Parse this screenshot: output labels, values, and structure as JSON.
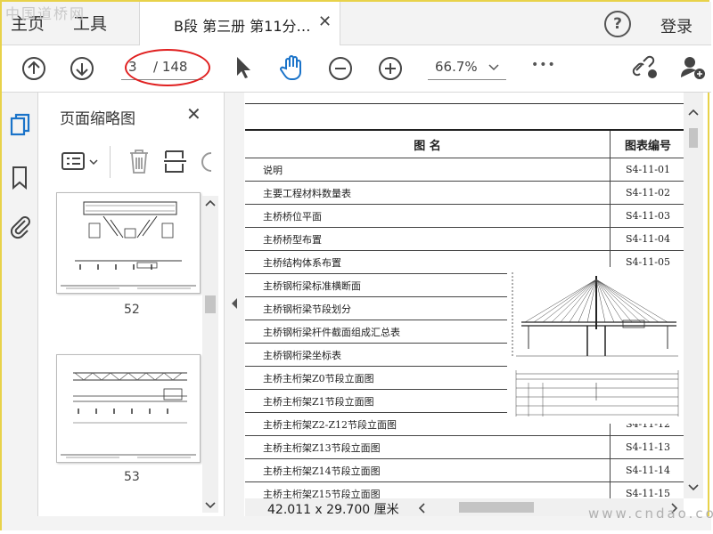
{
  "watermark_top": "中国道桥网",
  "menu": {
    "home": "主页",
    "tools": "工具"
  },
  "tab": {
    "title": "B段 第三册 第11分…",
    "close": "✕"
  },
  "header": {
    "help": "?",
    "login": "登录"
  },
  "toolbar": {
    "page_current": "3",
    "page_total": "/ 148",
    "zoom": "66.7%",
    "more": "•••"
  },
  "panel": {
    "title": "页面缩略图",
    "close": "✕",
    "thumbs": [
      {
        "label": "52"
      },
      {
        "label": "53"
      }
    ]
  },
  "document": {
    "header_name": "图  名",
    "header_code": "图表编号",
    "rows": [
      {
        "name": "说明",
        "code": "S4-11-01"
      },
      {
        "name": "主要工程材料数量表",
        "code": "S4-11-02"
      },
      {
        "name": "主桥桥位平面",
        "code": "S4-11-03"
      },
      {
        "name": "主桥桥型布置",
        "code": "S4-11-04"
      },
      {
        "name": "主桥结构体系布置",
        "code": "S4-11-05"
      },
      {
        "name": "主桥钢桁梁标准横断面",
        "code": ""
      },
      {
        "name": "主桥钢桁梁节段划分",
        "code": ""
      },
      {
        "name": "主桥钢桁梁杆件截面组成汇总表",
        "code": ""
      },
      {
        "name": "主桥钢桁梁坐标表",
        "code": ""
      },
      {
        "name": "主桥主桁架Z0节段立面图",
        "code": ""
      },
      {
        "name": "主桥主桁架Z1节段立面图",
        "code": ""
      },
      {
        "name": "主桥主桁架Z2-Z12节段立面图",
        "code": "S4-11-12"
      },
      {
        "name": "主桥主桁架Z13节段立面图",
        "code": "S4-11-13"
      },
      {
        "name": "主桥主桁架Z14节段立面图",
        "code": "S4-11-14"
      },
      {
        "name": "主桥主桁架Z15节段立面图",
        "code": "S4-11-15"
      }
    ],
    "dimensions": "42.011 x 29.700 厘米"
  },
  "watermark_bottom": "www.cndao.com"
}
